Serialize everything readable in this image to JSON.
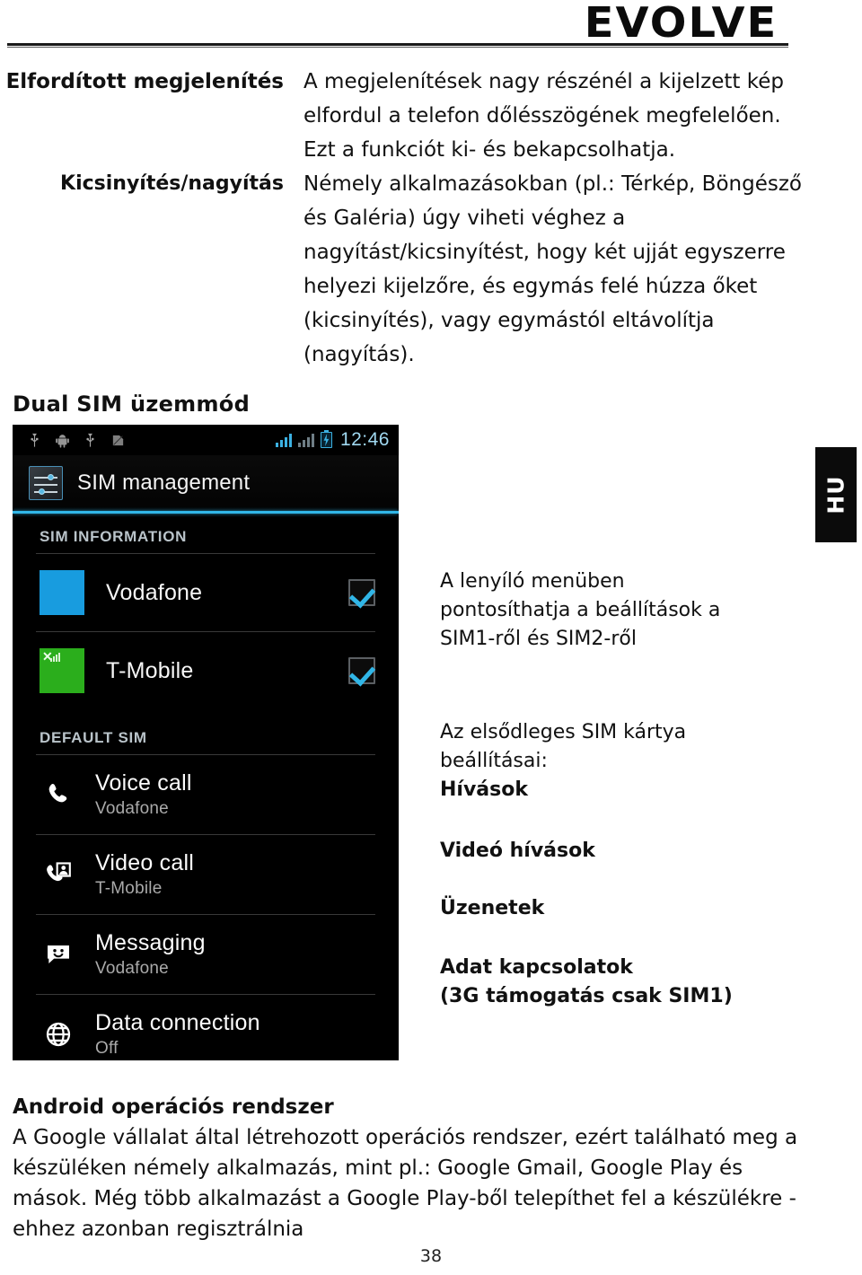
{
  "brand": {
    "logo_text": "EVOLVE"
  },
  "feature_table": {
    "rows": [
      {
        "label": "Elfordított megjelenítés",
        "body": "A megjelenítések nagy részénél a kijelzett kép elfordul a telefon dőlésszögének megfelelően. Ezt a funkciót ki- és bekapcsolhatja."
      },
      {
        "label": "Kicsinyítés/nagyítás",
        "body": "Némely alkalmazásokban (pl.: Térkép, Böngésző és Galéria) úgy viheti véghez a nagyítást/kicsinyítést, hogy két ujját egyszerre helyezi kijelzőre, és egymás felé húzza őket (kicsinyítés), vagy egymástól eltávolítja (nagyítás)."
      }
    ]
  },
  "section": {
    "title": "Dual SIM üzemmód"
  },
  "phone": {
    "status_bar": {
      "clock": "12:46",
      "icons": [
        "usb-icon",
        "android-robot-icon",
        "usb-icon",
        "sd-card-icon"
      ],
      "signal1": "signal-bars-icon",
      "signal2": "signal-bars-icon",
      "battery": "battery-charging-icon"
    },
    "action_bar": {
      "title": "SIM management",
      "icon": "sim-management-icon"
    },
    "sim_information": {
      "header": "SIM INFORMATION",
      "items": [
        {
          "name": "Vodafone",
          "color": "#1a9bdd",
          "checked": true,
          "chip": "plain"
        },
        {
          "name": "T-Mobile",
          "color": "#2dad1e",
          "checked": true,
          "chip": "signal"
        }
      ]
    },
    "default_sim": {
      "header": "DEFAULT SIM",
      "items": [
        {
          "title": "Voice call",
          "subtitle": "Vodafone",
          "icon": "phone-handset-icon"
        },
        {
          "title": "Video call",
          "subtitle": "T-Mobile",
          "icon": "video-call-icon"
        },
        {
          "title": "Messaging",
          "subtitle": "Vodafone",
          "icon": "message-bubble-icon"
        },
        {
          "title": "Data connection",
          "subtitle": "Off",
          "icon": "globe-icon"
        }
      ]
    }
  },
  "annotations": {
    "a1_line1": "A lenyíló menüben",
    "a1_line2": "pontosíthatja a beállítások a",
    "a1_line3": "SIM1-ről és SIM2-ről",
    "a2_line1": "Az elsődleges SIM kártya",
    "a2_line2": "beállításai:",
    "a2_bold": "Hívások",
    "a3": "Videó hívások",
    "a4": "Üzenetek",
    "a5_line1": "Adat kapcsolatok",
    "a5_line2": "(3G támogatás csak SIM1)"
  },
  "side_tab": {
    "label": "HU"
  },
  "bottom": {
    "heading": "Android operációs rendszer",
    "paragraph": "A Google vállalat által létrehozott operációs rendszer, ezért található meg a készüléken némely alkalmazás, mint pl.: Google Gmail, Google Play és mások. Még több alkalmazást a Google Play-ből telepíthet fel a készülékre - ehhez azonban regisztrálnia"
  },
  "footer": {
    "page_number": "38"
  }
}
